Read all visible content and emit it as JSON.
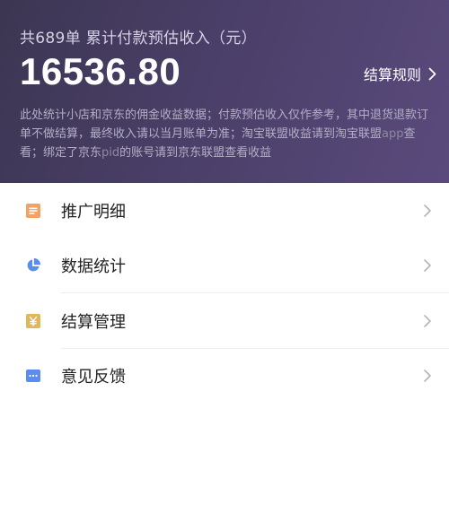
{
  "header": {
    "summary": "共689单  累计付款预估收入（元）",
    "amount": "16536.80",
    "rules_label": "结算规则",
    "notice_part1": "此处统计小店和京东的佣金收益数据；付款预估收入仅作参考，其中退货退款订单不做结算，最终收入请以当月账单为准；淘宝联盟收益请到淘宝联盟",
    "notice_app": "app",
    "notice_part2": "查看；绑定了京东",
    "notice_pid": "pid",
    "notice_part3": "的账号请到京东联盟查看收益"
  },
  "menu": {
    "items": [
      {
        "label": "推广明细",
        "icon": "list-document-icon",
        "color": "#f4a263"
      },
      {
        "label": "数据统计",
        "icon": "pie-chart-icon",
        "color": "#5b8def"
      },
      {
        "label": "结算管理",
        "icon": "yen-icon",
        "color": "#e0b75b"
      },
      {
        "label": "意见反馈",
        "icon": "chat-bubble-icon",
        "color": "#5b8def"
      }
    ]
  }
}
